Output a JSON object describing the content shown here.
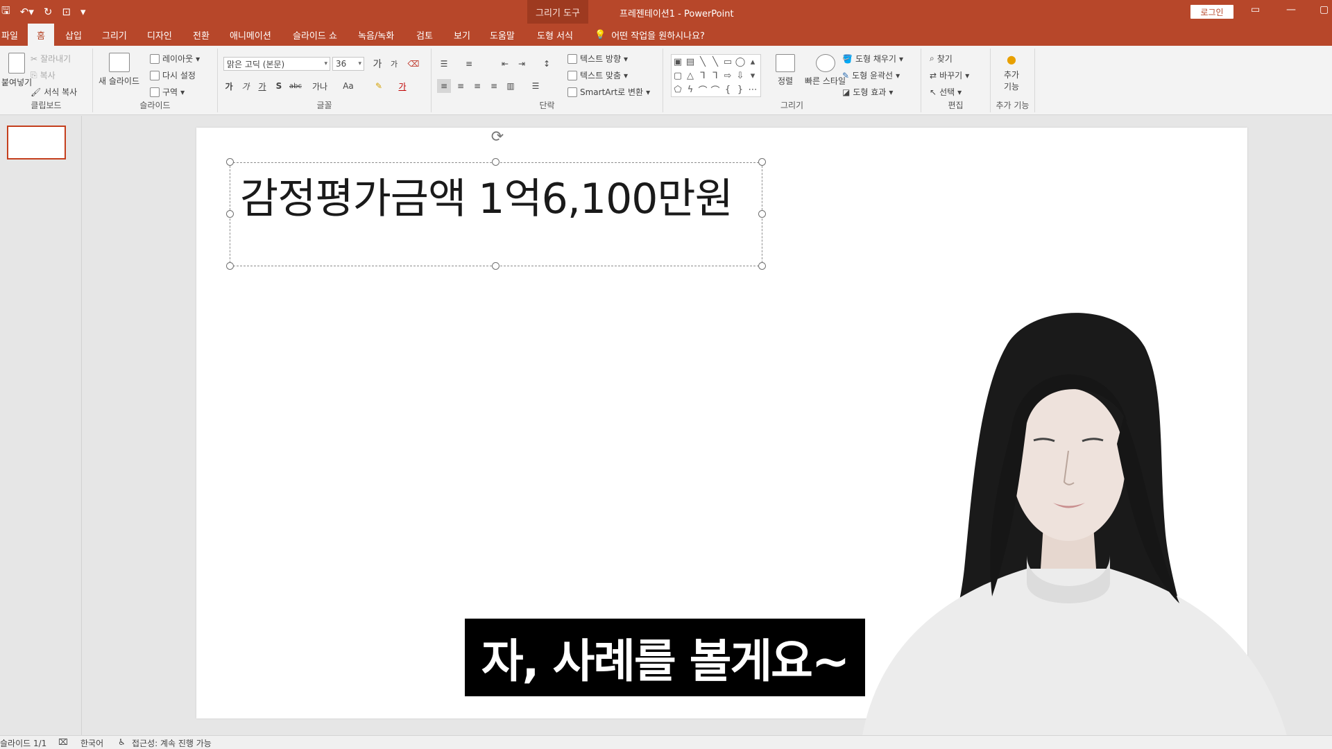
{
  "titlebar": {
    "context_tab": "그리기 도구",
    "document_title": "프레젠테이션1 - PowerPoint",
    "login_label": "로그인",
    "accent_color": "#b7472a"
  },
  "tabs": {
    "file": "파일",
    "home": "홈",
    "insert": "삽입",
    "draw": "그리기",
    "design": "디자인",
    "transitions": "전환",
    "animations": "애니메이션",
    "slideshow": "슬라이드 쇼",
    "record": "녹음/녹화",
    "review": "검토",
    "view": "보기",
    "help": "도움말",
    "shape_format": "도형 서식",
    "tell_me": "어떤 작업을 원하시나요?"
  },
  "ribbon": {
    "clipboard": {
      "label": "클립보드",
      "paste": "붙여넣기",
      "cut": "잘라내기",
      "copy": "복사",
      "format_painter": "서식 복사"
    },
    "slides": {
      "label": "슬라이드",
      "new_slide": "새 슬라이드",
      "layout": "레이아웃",
      "reset": "다시 설정",
      "section": "구역"
    },
    "font": {
      "label": "글꼴",
      "font_name": "맑은 고딕 (본문)",
      "font_size": "36",
      "grow": "가",
      "shrink": "가",
      "bold": "가",
      "italic": "가",
      "underline": "가",
      "shadow": "S",
      "strike": "abc",
      "spacing": "가나",
      "case": "Aa"
    },
    "paragraph": {
      "label": "단락",
      "text_direction": "텍스트 방향",
      "align_text": "텍스트 맞춤",
      "smartart": "SmartArt로 변환"
    },
    "drawing": {
      "label": "그리기",
      "arrange": "정렬",
      "quick_styles": "빠른 스타일",
      "fill": "도형 채우기",
      "outline": "도형 윤곽선",
      "effects": "도형 효과"
    },
    "editing": {
      "label": "편집",
      "find": "찾기",
      "replace": "바꾸기",
      "select": "선택"
    },
    "addins": {
      "label": "추가 기능",
      "button": "추가 기능"
    }
  },
  "slide": {
    "text": "감정평가금액 1억6,100만원"
  },
  "subtitle": "자, 사례를 볼게요~",
  "statusbar": {
    "slide_count": "슬라이드 1/1",
    "language": "한국어",
    "accessibility": "접근성: 계속 진행 가능"
  }
}
